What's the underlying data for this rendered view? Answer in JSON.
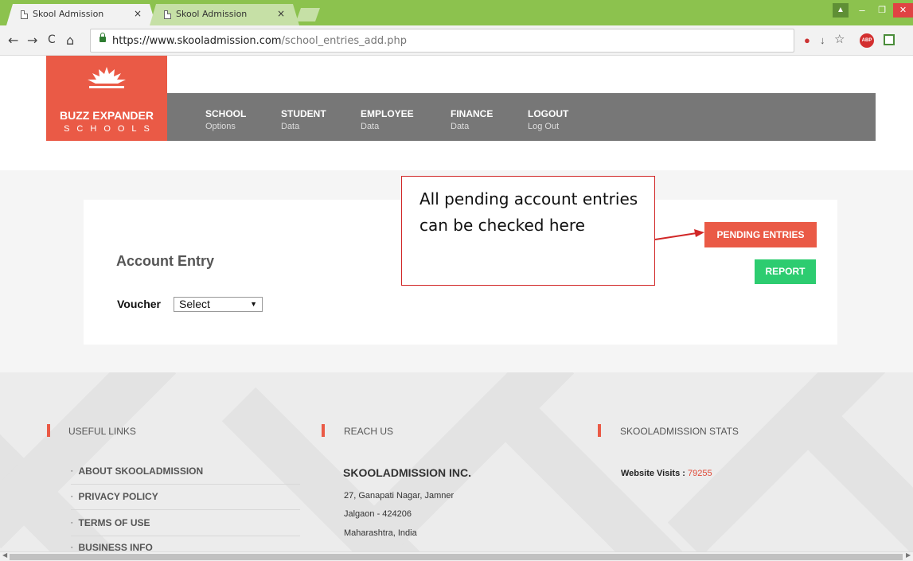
{
  "browser": {
    "tabs": [
      {
        "title": "Skool Admission",
        "close": "×"
      },
      {
        "title": "Skool Admission",
        "close": "×"
      }
    ],
    "url_prefix": "https://",
    "url_domain": "www.skooladmission.com",
    "url_path": "/school_entries_add.php",
    "nav": {
      "back": "←",
      "forward": "→",
      "reload": "C",
      "home": "⌂"
    },
    "window_controls": {
      "user": "▲",
      "minimize": "–",
      "restore": "❐",
      "close": "✕"
    },
    "extensions": {
      "abp": "ABP"
    }
  },
  "logo": {
    "brand": "BUZZ EXPANDER",
    "sub": "SCHOOLS"
  },
  "nav": {
    "items": [
      {
        "title": "SCHOOL",
        "sub": "Options"
      },
      {
        "title": "STUDENT",
        "sub": "Data"
      },
      {
        "title": "EMPLOYEE",
        "sub": "Data"
      },
      {
        "title": "FINANCE",
        "sub": "Data"
      },
      {
        "title": "LOGOUT",
        "sub": "Log Out"
      }
    ]
  },
  "main": {
    "title": "Account Entry",
    "voucher_label": "Voucher",
    "voucher_selected": "Select",
    "pending_button": "PENDING ENTRIES",
    "report_button": "REPORT",
    "callout": "All pending account entries can be checked here"
  },
  "footer": {
    "useful_links_heading": "USEFUL LINKS",
    "links": [
      "ABOUT SKOOLADMISSION",
      "PRIVACY POLICY",
      "TERMS OF USE",
      "BUSINESS INFO"
    ],
    "reach_heading": "REACH US",
    "company": "SKOOLADMISSION INC.",
    "address": [
      "27, Ganapati Nagar, Jamner",
      "Jalgaon - 424206",
      "Maharashtra, India"
    ],
    "stats_heading": "SKOOLADMISSION STATS",
    "visits_label": "Website Visits : ",
    "visits_count": "79255"
  },
  "colors": {
    "accent": "#ea5a46",
    "report": "#2dcc70",
    "nav": "#777777",
    "tabstrip": "#8cc24e"
  }
}
